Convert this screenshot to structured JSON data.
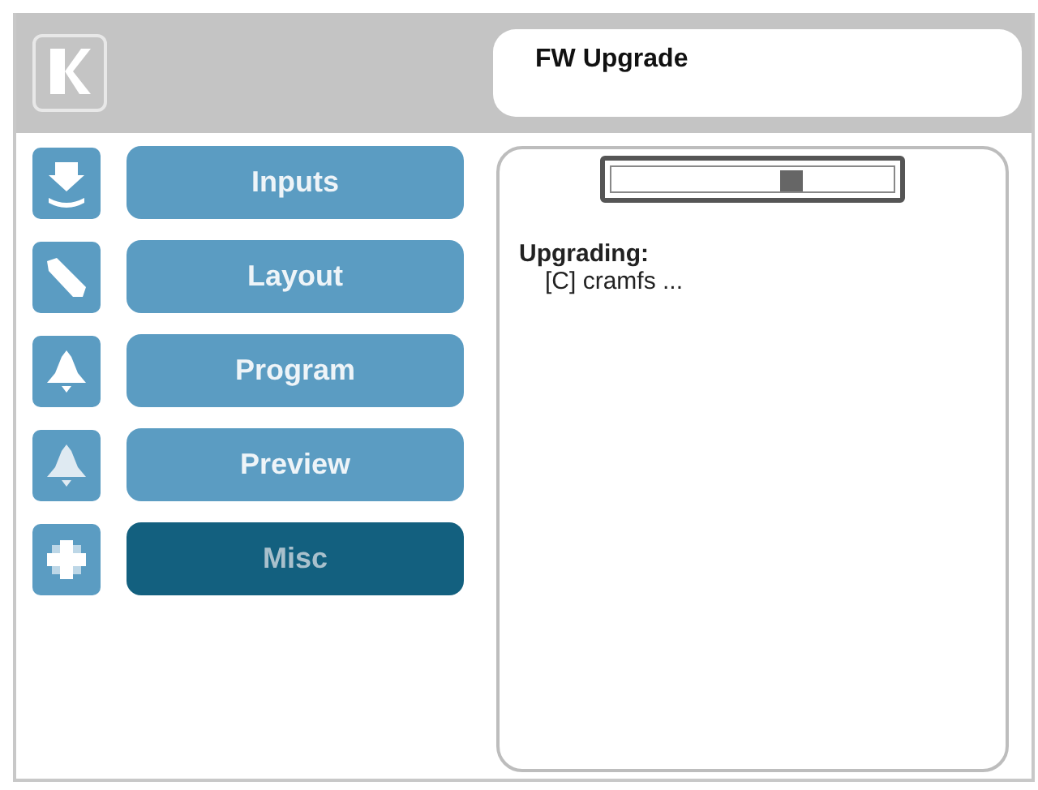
{
  "header": {
    "title": "FW Upgrade"
  },
  "menu": [
    {
      "label": "Inputs",
      "selected": false
    },
    {
      "label": "Layout",
      "selected": false
    },
    {
      "label": "Program",
      "selected": false
    },
    {
      "label": "Preview",
      "selected": false
    },
    {
      "label": "Misc",
      "selected": true
    }
  ],
  "content": {
    "heading": "Upgrading:",
    "lines": [
      "[C] cramfs ..."
    ]
  }
}
